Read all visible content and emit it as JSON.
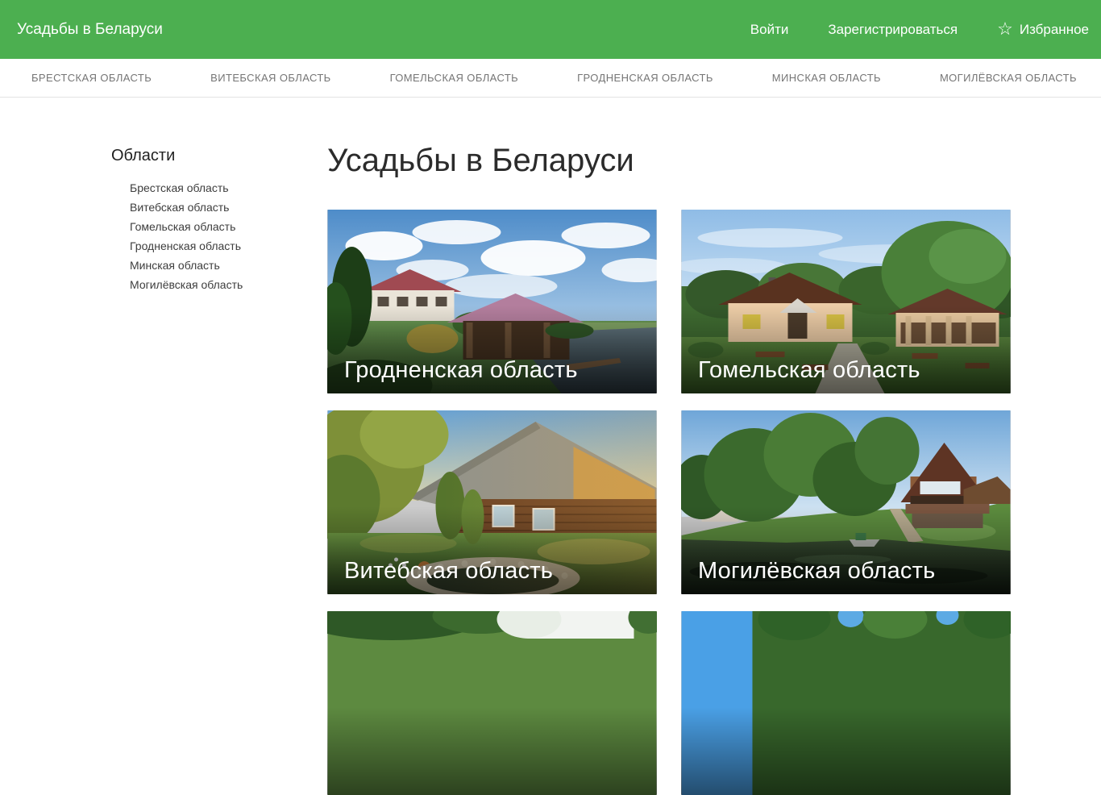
{
  "header": {
    "brand": "Усадьбы в Беларуси",
    "login_label": "Войти",
    "register_label": "Зарегистрироваться",
    "favorites_label": "Избранное",
    "favorites_icon": "star-outline",
    "favorites_icon_glyph": "☆",
    "background_color": "#4caf50"
  },
  "nav": {
    "items": [
      "БРЕСТСКАЯ ОБЛАСТЬ",
      "ВИТЕБСКАЯ ОБЛАСТЬ",
      "ГОМЕЛЬСКАЯ ОБЛАСТЬ",
      "ГРОДНЕНСКАЯ ОБЛАСТЬ",
      "МИНСКАЯ ОБЛАСТЬ",
      "МОГИЛЁВСКАЯ ОБЛАСТЬ"
    ]
  },
  "sidebar": {
    "title": "Области",
    "items": [
      "Брестская область",
      "Витебская область",
      "Гомельская область",
      "Гродненская область",
      "Минская область",
      "Могилёвская область"
    ]
  },
  "main": {
    "title": "Усадьбы в Беларуси",
    "cards": [
      {
        "caption": "Гродненская область",
        "photo": "pond-pavilion-country-house"
      },
      {
        "caption": "Гомельская область",
        "photo": "two-cottages-green-lawn"
      },
      {
        "caption": "Витебская область",
        "photo": "log-house-garden-golden-hour"
      },
      {
        "caption": "Могилёвская область",
        "photo": "riverbank-wooden-house"
      },
      {
        "caption": "",
        "photo": "trees-sky-partially-visible"
      },
      {
        "caption": "",
        "photo": "blue-sky-trees-partially-visible"
      }
    ]
  },
  "colors": {
    "accent_green": "#4caf50",
    "nav_text": "#757575",
    "heading_text": "#2b2b2b"
  }
}
